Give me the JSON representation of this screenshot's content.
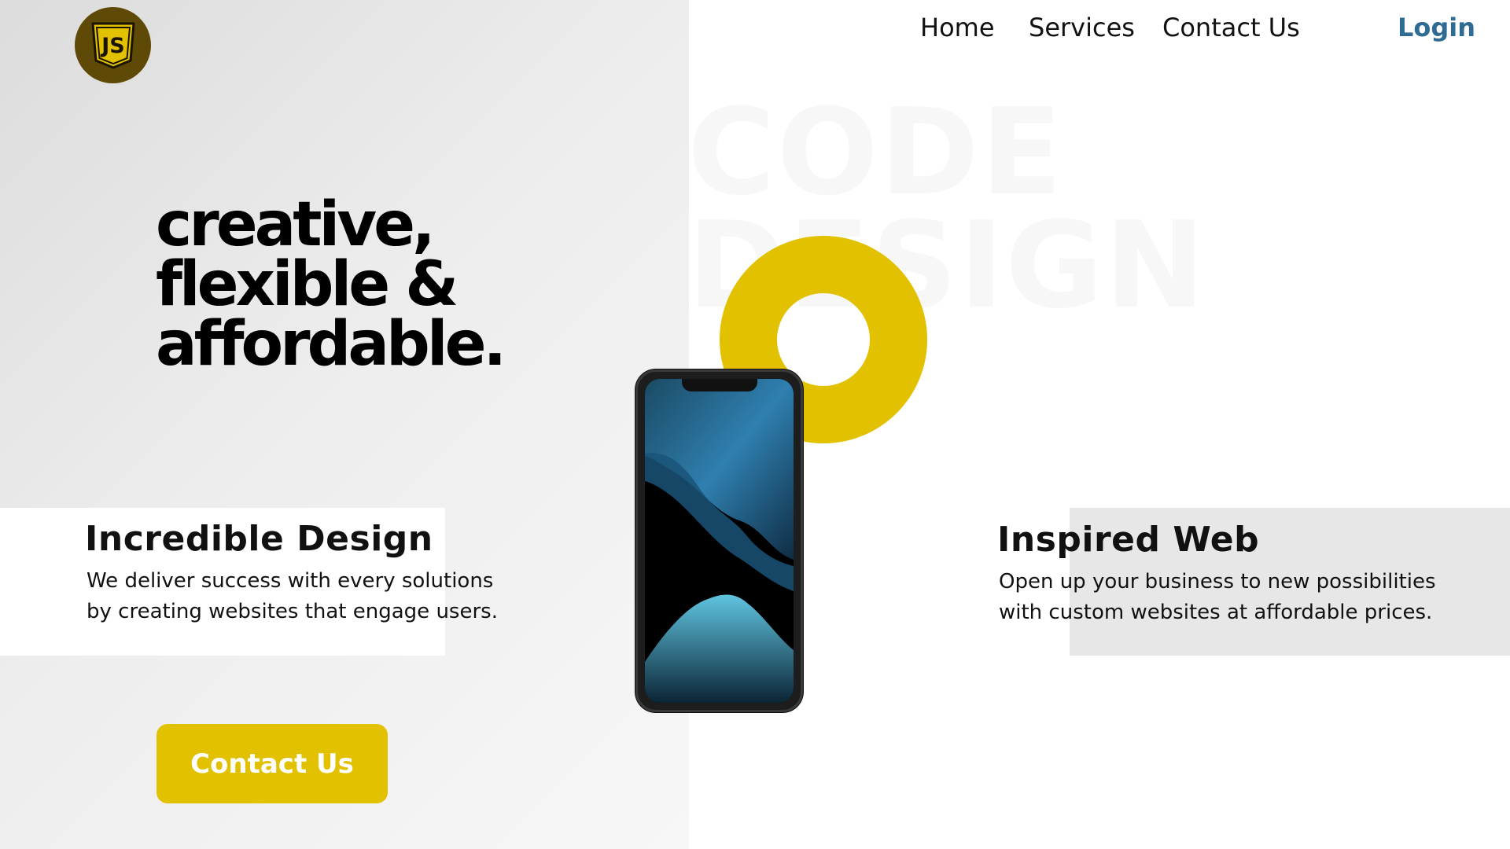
{
  "brand": {
    "logo_text": "JS",
    "accent_color": "#e2c100",
    "logo_bg_color": "#5e4a06"
  },
  "nav": {
    "home": "Home",
    "services": "Services",
    "contact": "Contact Us",
    "login": "Login",
    "login_color": "#2e6c93"
  },
  "background_text": {
    "line1": "CODE",
    "line2": "DESIGN"
  },
  "hero": {
    "headline_lines": [
      "creative,",
      "flexible &",
      "affordable."
    ]
  },
  "features": [
    {
      "title": "Incredible Design",
      "lines": [
        "We deliver success with every solutions",
        "by creating websites that engage users."
      ]
    },
    {
      "title": "Inspired Web",
      "lines": [
        "Open up your business to new possibilities",
        "with custom websites at affordable prices."
      ]
    }
  ],
  "cta": {
    "label": "Contact Us"
  },
  "icons": {
    "logo": "js-shield-icon",
    "phone": "smartphone-image"
  }
}
